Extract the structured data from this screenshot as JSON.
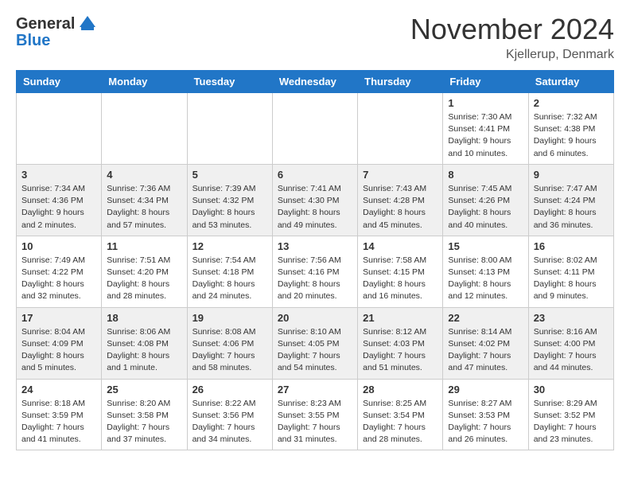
{
  "header": {
    "logo_general": "General",
    "logo_blue": "Blue",
    "month_title": "November 2024",
    "location": "Kjellerup, Denmark"
  },
  "weekdays": [
    "Sunday",
    "Monday",
    "Tuesday",
    "Wednesday",
    "Thursday",
    "Friday",
    "Saturday"
  ],
  "weeks": [
    [
      {
        "day": "",
        "info": ""
      },
      {
        "day": "",
        "info": ""
      },
      {
        "day": "",
        "info": ""
      },
      {
        "day": "",
        "info": ""
      },
      {
        "day": "",
        "info": ""
      },
      {
        "day": "1",
        "info": "Sunrise: 7:30 AM\nSunset: 4:41 PM\nDaylight: 9 hours\nand 10 minutes."
      },
      {
        "day": "2",
        "info": "Sunrise: 7:32 AM\nSunset: 4:38 PM\nDaylight: 9 hours\nand 6 minutes."
      }
    ],
    [
      {
        "day": "3",
        "info": "Sunrise: 7:34 AM\nSunset: 4:36 PM\nDaylight: 9 hours\nand 2 minutes."
      },
      {
        "day": "4",
        "info": "Sunrise: 7:36 AM\nSunset: 4:34 PM\nDaylight: 8 hours\nand 57 minutes."
      },
      {
        "day": "5",
        "info": "Sunrise: 7:39 AM\nSunset: 4:32 PM\nDaylight: 8 hours\nand 53 minutes."
      },
      {
        "day": "6",
        "info": "Sunrise: 7:41 AM\nSunset: 4:30 PM\nDaylight: 8 hours\nand 49 minutes."
      },
      {
        "day": "7",
        "info": "Sunrise: 7:43 AM\nSunset: 4:28 PM\nDaylight: 8 hours\nand 45 minutes."
      },
      {
        "day": "8",
        "info": "Sunrise: 7:45 AM\nSunset: 4:26 PM\nDaylight: 8 hours\nand 40 minutes."
      },
      {
        "day": "9",
        "info": "Sunrise: 7:47 AM\nSunset: 4:24 PM\nDaylight: 8 hours\nand 36 minutes."
      }
    ],
    [
      {
        "day": "10",
        "info": "Sunrise: 7:49 AM\nSunset: 4:22 PM\nDaylight: 8 hours\nand 32 minutes."
      },
      {
        "day": "11",
        "info": "Sunrise: 7:51 AM\nSunset: 4:20 PM\nDaylight: 8 hours\nand 28 minutes."
      },
      {
        "day": "12",
        "info": "Sunrise: 7:54 AM\nSunset: 4:18 PM\nDaylight: 8 hours\nand 24 minutes."
      },
      {
        "day": "13",
        "info": "Sunrise: 7:56 AM\nSunset: 4:16 PM\nDaylight: 8 hours\nand 20 minutes."
      },
      {
        "day": "14",
        "info": "Sunrise: 7:58 AM\nSunset: 4:15 PM\nDaylight: 8 hours\nand 16 minutes."
      },
      {
        "day": "15",
        "info": "Sunrise: 8:00 AM\nSunset: 4:13 PM\nDaylight: 8 hours\nand 12 minutes."
      },
      {
        "day": "16",
        "info": "Sunrise: 8:02 AM\nSunset: 4:11 PM\nDaylight: 8 hours\nand 9 minutes."
      }
    ],
    [
      {
        "day": "17",
        "info": "Sunrise: 8:04 AM\nSunset: 4:09 PM\nDaylight: 8 hours\nand 5 minutes."
      },
      {
        "day": "18",
        "info": "Sunrise: 8:06 AM\nSunset: 4:08 PM\nDaylight: 8 hours\nand 1 minute."
      },
      {
        "day": "19",
        "info": "Sunrise: 8:08 AM\nSunset: 4:06 PM\nDaylight: 7 hours\nand 58 minutes."
      },
      {
        "day": "20",
        "info": "Sunrise: 8:10 AM\nSunset: 4:05 PM\nDaylight: 7 hours\nand 54 minutes."
      },
      {
        "day": "21",
        "info": "Sunrise: 8:12 AM\nSunset: 4:03 PM\nDaylight: 7 hours\nand 51 minutes."
      },
      {
        "day": "22",
        "info": "Sunrise: 8:14 AM\nSunset: 4:02 PM\nDaylight: 7 hours\nand 47 minutes."
      },
      {
        "day": "23",
        "info": "Sunrise: 8:16 AM\nSunset: 4:00 PM\nDaylight: 7 hours\nand 44 minutes."
      }
    ],
    [
      {
        "day": "24",
        "info": "Sunrise: 8:18 AM\nSunset: 3:59 PM\nDaylight: 7 hours\nand 41 minutes."
      },
      {
        "day": "25",
        "info": "Sunrise: 8:20 AM\nSunset: 3:58 PM\nDaylight: 7 hours\nand 37 minutes."
      },
      {
        "day": "26",
        "info": "Sunrise: 8:22 AM\nSunset: 3:56 PM\nDaylight: 7 hours\nand 34 minutes."
      },
      {
        "day": "27",
        "info": "Sunrise: 8:23 AM\nSunset: 3:55 PM\nDaylight: 7 hours\nand 31 minutes."
      },
      {
        "day": "28",
        "info": "Sunrise: 8:25 AM\nSunset: 3:54 PM\nDaylight: 7 hours\nand 28 minutes."
      },
      {
        "day": "29",
        "info": "Sunrise: 8:27 AM\nSunset: 3:53 PM\nDaylight: 7 hours\nand 26 minutes."
      },
      {
        "day": "30",
        "info": "Sunrise: 8:29 AM\nSunset: 3:52 PM\nDaylight: 7 hours\nand 23 minutes."
      }
    ]
  ]
}
